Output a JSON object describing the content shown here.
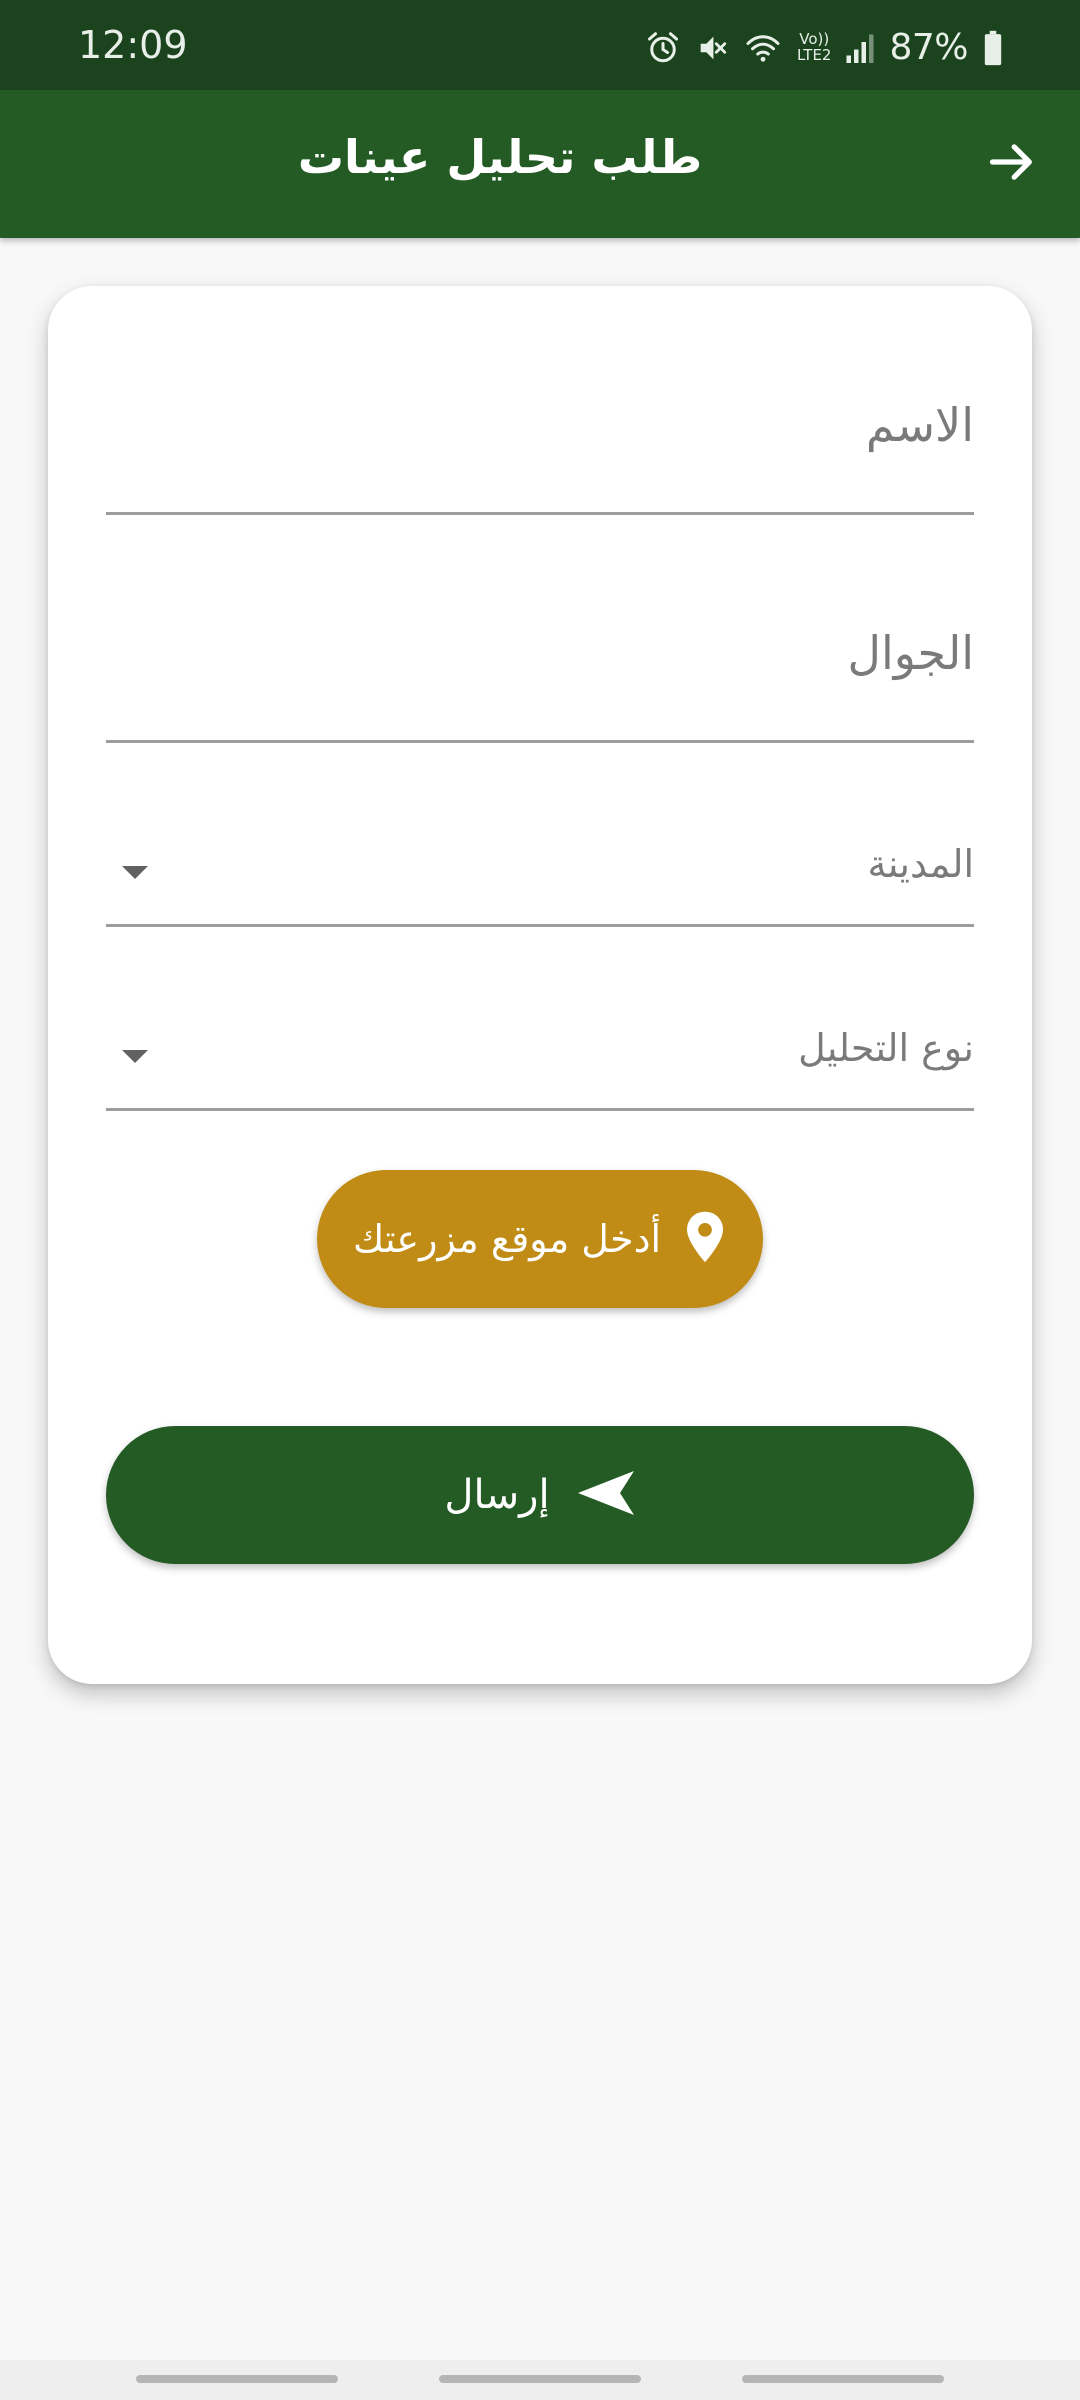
{
  "status_bar": {
    "time": "12:09",
    "battery": "87%",
    "icons": [
      "alarm-icon",
      "vibrate-mute-icon",
      "wifi-icon",
      "volte-lte2-icon",
      "signal-icon",
      "battery-icon"
    ],
    "volte_label": "Vo))",
    "lte_label": "LTE2"
  },
  "app_bar": {
    "title": "طلب تحليل عينات",
    "back_icon": "arrow-right-icon"
  },
  "form": {
    "name_label": "الاسم",
    "phone_label": "الجوال",
    "city_label": "المدينة",
    "analysis_type_label": "نوع التحليل",
    "location_button_label": "أدخل موقع مزرعتك",
    "location_icon": "map-pin-icon",
    "submit_button_label": "إرسال",
    "submit_icon": "send-icon"
  },
  "colors": {
    "status_bar": "#1b441e",
    "primary": "#245b24",
    "accent": "#c08c16",
    "background": "#f8f8f8",
    "card": "#ffffff"
  }
}
